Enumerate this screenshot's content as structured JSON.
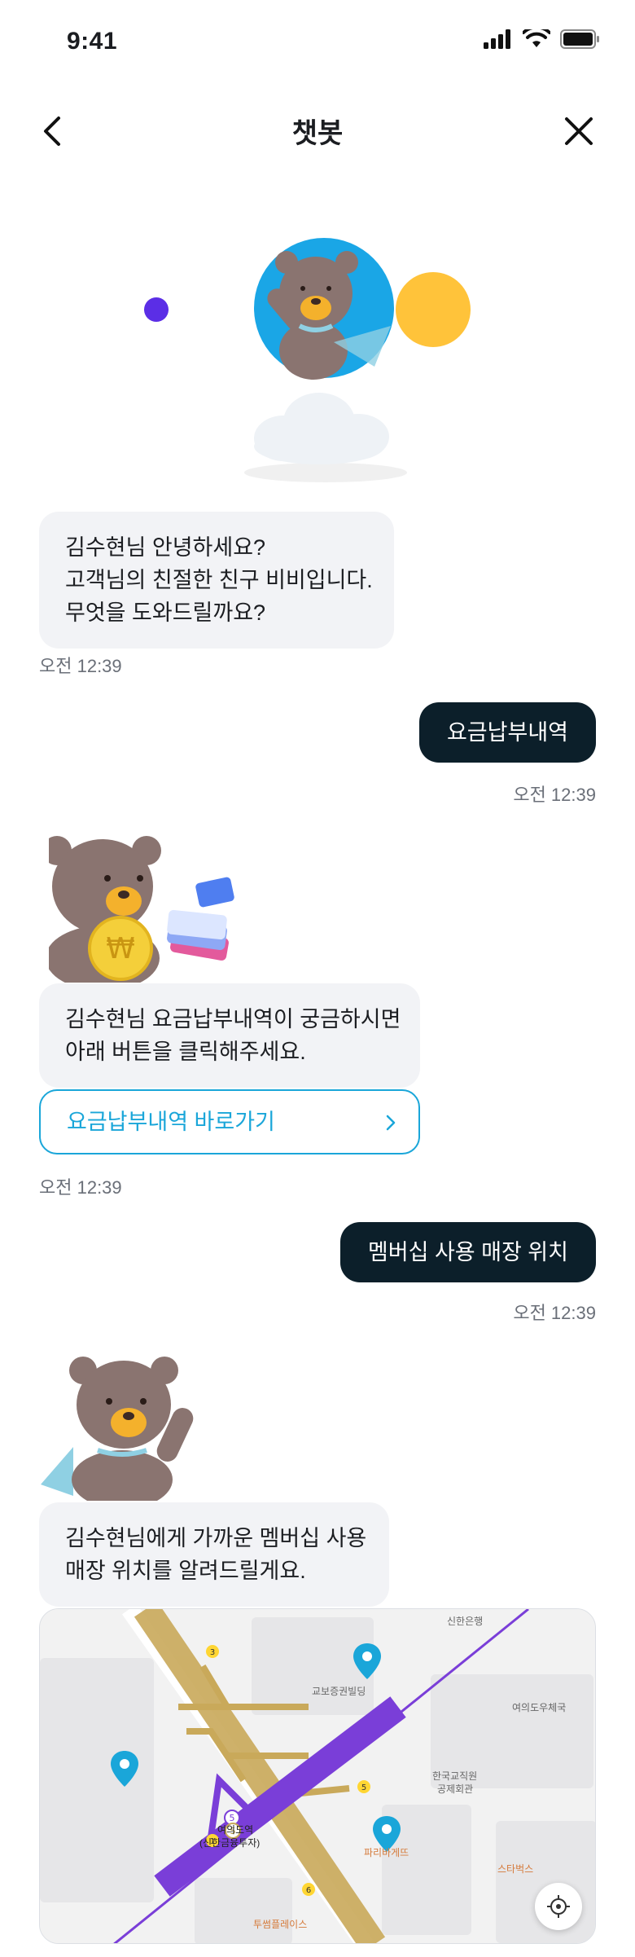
{
  "status_bar": {
    "time": "9:41"
  },
  "header": {
    "title": "챗봇"
  },
  "messages": {
    "bot1": {
      "lines": [
        "김수현님 안녕하세요?",
        "고객님의 친절한 친구 비비입니다.",
        "무엇을 도와드릴까요?"
      ],
      "time": "오전 12:39"
    },
    "user1": {
      "text": "요금납부내역",
      "time": "오전 12:39"
    },
    "bot2": {
      "lines": [
        "김수현님 요금납부내역이 궁금하시면",
        "아래 버튼을 클릭해주세요."
      ],
      "button": "요금납부내역 바로가기",
      "time": "오전 12:39"
    },
    "user2": {
      "text": "멤버십 사용 매장 위치",
      "time": "오전 12:39"
    },
    "bot3": {
      "lines": [
        "김수현님에게 가까운 멤버십 사용",
        "매장 위치를 알려드릴게요."
      ]
    }
  },
  "map": {
    "labels": {
      "shinhan_bank": "신한은행",
      "kyobo": "교보증권빌딩",
      "post_office": "여의도우체국",
      "teachers": "한국교직원",
      "teachers2": "공제회관",
      "station": "여의도역",
      "station2": "(신한금융투자)",
      "paris": "파리바게뜨",
      "starbucks": "스타벅스",
      "tuplace": "투썸플레이스"
    }
  },
  "colors": {
    "primary_dark": "#0c1f2a",
    "accent": "#1aa6d9",
    "bubble_bg": "#f2f3f6",
    "hero_blue": "#1aa6e6",
    "hero_yellow": "#ffc33a",
    "hero_purple": "#5b2ee6",
    "map_line_purple": "#7a3ed8",
    "map_line_gold": "#c9a95a"
  },
  "icons": [
    "back-arrow-icon",
    "close-icon",
    "signal-icon",
    "wifi-icon",
    "battery-icon",
    "chevron-right-icon",
    "map-pin-icon",
    "locate-icon"
  ]
}
